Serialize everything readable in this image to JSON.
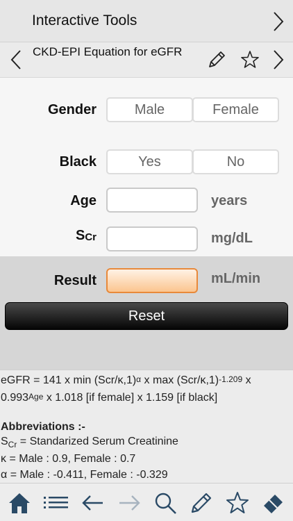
{
  "top_bar": {
    "title": "Interactive Tools"
  },
  "sub_bar": {
    "title": "CKD-EPI Equation for eGFR"
  },
  "form": {
    "gender": {
      "label": "Gender",
      "options": [
        "Male",
        "Female"
      ]
    },
    "black": {
      "label": "Black",
      "options": [
        "Yes",
        "No"
      ]
    },
    "age": {
      "label": "Age",
      "value": "",
      "unit": "years"
    },
    "scr": {
      "label_main": "S",
      "label_sub": "Cr",
      "value": "",
      "unit": "mg/dL"
    }
  },
  "result": {
    "label": "Result",
    "value": "",
    "unit": "mL/min"
  },
  "reset": {
    "label": "Reset"
  },
  "info": {
    "l1_a": "eGFR = 141 x min (Scr/κ,1)",
    "l1_sup1": "α",
    "l1_b": " x max (Scr/κ,1)",
    "l1_sup2": "-1.209",
    "l1_c": " x",
    "l2_a": "0.993",
    "l2_sup": "Age",
    "l2_b": " x 1.018 [if female] x 1.159 [if black]",
    "abbr": "Abbreviations :-",
    "scr_main": "S",
    "scr_sub": "Cr",
    "scr_def": " = Standarized Serum Creatinine",
    "kappa": "κ = Male : 0.9, Female : 0.7",
    "alpha": "α = Male : -0.411, Female : -0.329"
  },
  "icons": [
    "chevron-right-icon",
    "chevron-left-icon",
    "pencil-icon",
    "star-icon",
    "home-icon",
    "list-icon",
    "arrow-left-icon",
    "arrow-right-icon",
    "search-icon",
    "eraser-icon"
  ]
}
